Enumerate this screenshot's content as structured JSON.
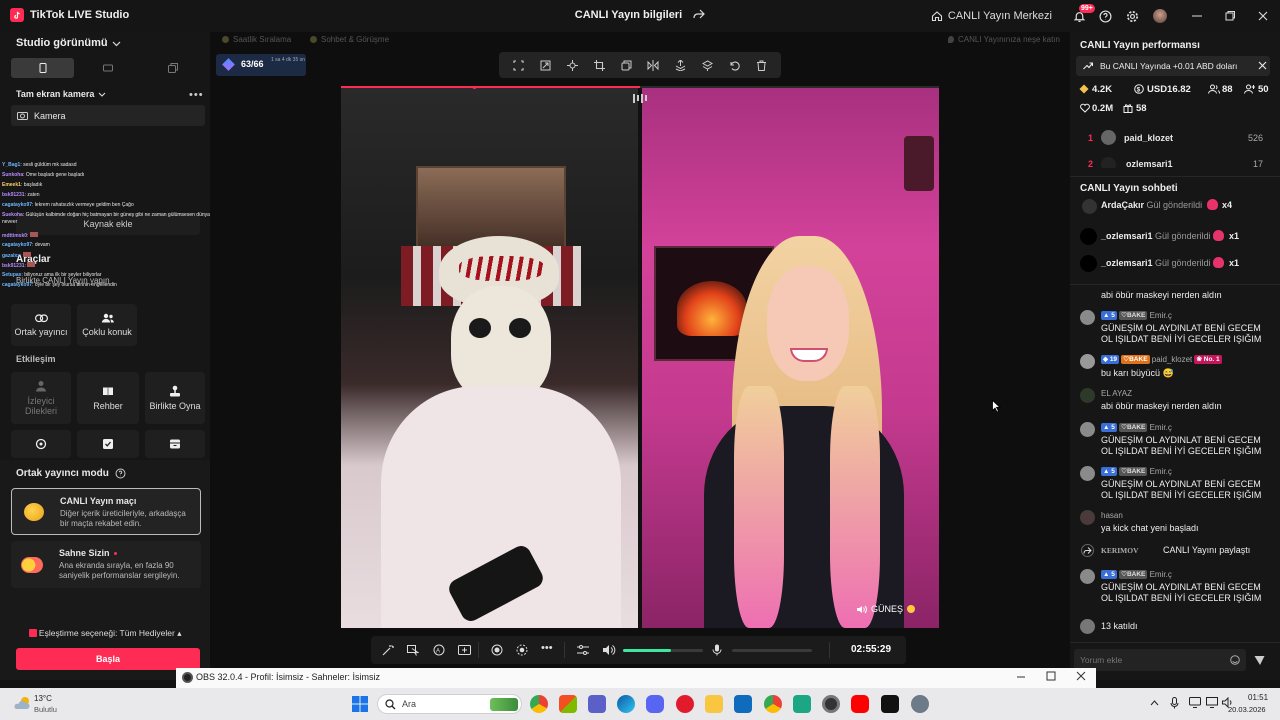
{
  "app": {
    "brand": "TikTok LIVE Studio",
    "title": "CANLI Yayın bilgileri",
    "center_button": "CANLI Yayın Merkezi",
    "notif_badge": "99+",
    "accent": "#fe2c55"
  },
  "left": {
    "studio_view": "Studio görünümü",
    "fullscreen_camera": "Tam ekran kamera",
    "camera": "Kamera",
    "add_source": "Kaynak ekle",
    "tools": "Araçlar",
    "play_together_note": "Birlikte CANLI Yayın yapın",
    "co_host": "Ortak yayıncı",
    "multi_guest": "Çoklu konuk",
    "interaction": "Etkileşim",
    "viewer_requests": "İzleyici Dilekleri",
    "guide": "Rehber",
    "play_together": "Birlikte Oyna",
    "co_host_mode": "Ortak yayıncı modu",
    "match_title": "CANLI Yayın maçı",
    "match_desc": "Diğer içerik üreticileriyle, arkadaşça bir maçta rekabet edin.",
    "stage_title": "Sahne Sizin",
    "stage_desc": "Ana ekranda sırayla, en fazla 90 saniyelik performanslar sergileyin.",
    "matching_option": "Eşleştirme seçeneği: Tüm Hediyeler",
    "start_button": "Başla",
    "overlay_chat": [
      {
        "user": "Y_Bag1",
        "text": "sesli güldüm mk sadasd",
        "color": "#6bb6ff"
      },
      {
        "user": "Sunkoha",
        "text": "Ome başladı gene başladı",
        "color": "#b88cff"
      },
      {
        "user": "Emeek1",
        "text": "başladık",
        "color": "#ffd166"
      },
      {
        "user": "bsk91231",
        "text": "zaten",
        "color": "#b88cff"
      },
      {
        "user": "cagatayko97",
        "text": "lekrem rahatsızlık vermeye geldim ben Çağo",
        "color": "#6bb6ff"
      },
      {
        "user": "Suekoha",
        "text": "Gülüşün kalbimde doğan hiç batmayan bir güneş gibi ne zaman gülümsesen dünyam",
        "color": "#b88cff"
      },
      {
        "user": "",
        "text": "neveer",
        "color": "#6bb6ff"
      },
      {
        "user": "mdttimsk0",
        "text": "",
        "color": "#b88cff"
      },
      {
        "user": "cagatayko97",
        "text": "devam",
        "color": "#6bb6ff"
      },
      {
        "user": "gazalxx",
        "text": "",
        "color": "#6bb6ff"
      },
      {
        "user": "bsk91231",
        "text": "",
        "color": "#b88cff"
      },
      {
        "user": "Setupas",
        "text": "biliyoruz ama ilk bir şeyler biliyorlar",
        "color": "#6bb6ff"
      },
      {
        "user": "cagatayko97",
        "text": "öyle bir şey olursa birinin engellendin",
        "color": "#6bb6ff"
      }
    ]
  },
  "stage": {
    "tab1": "Saatlik Sıralama",
    "tab2": "Sohbet & Görüşme",
    "right_hint": "CANLI Yayınınıza neşe katın",
    "counter": "63/66",
    "counter_sub": "1 sa 4 dk 35 sn",
    "guest_name": "GÜNEŞ",
    "timer": "02:55:29",
    "volume_level": 0.6
  },
  "right": {
    "performance_title": "CANLI Yayın performansı",
    "earn_note": "Bu CANLI Yayında +0.01 ABD doları",
    "stats": {
      "diamonds": "4.2K",
      "usd": "USD16.82",
      "viewers": "88",
      "followers": "50",
      "likes": "0.2M",
      "gifts": "58"
    },
    "top_viewers": [
      {
        "rank": "1",
        "name": "paid_klozet",
        "score": "526"
      },
      {
        "rank": "2",
        "name": "ozlemsari1",
        "score": "17"
      }
    ],
    "chat_title": "CANLI Yayın sohbeti",
    "gifts": [
      {
        "user": "ArdaÇakır",
        "action": "Gül gönderildi",
        "count": "x4"
      },
      {
        "user": "_ozlemsari1",
        "action": "Gül gönderildi",
        "count": "x1"
      },
      {
        "user": "_ozlemsari1",
        "action": "Gül gönderildi",
        "count": "x1"
      }
    ],
    "messages": {
      "m0": "abi öbür maskeyi nerden aldın",
      "m1_user": "Emir.ç",
      "m1_text": "GÜNEŞİM OL AYDINLAT BENİ GECEM OL IŞILDAT BENİ İYİ GECELER IŞIĞIM",
      "m2_user": "paid_klozet",
      "m2_level": "19",
      "m2_badge": "BAKE",
      "m2_no": "No. 1",
      "m2_text": "bu karı büyücü 😅",
      "m3_user": "EL AYAZ",
      "m3_text": "abi öbür maskeyi nerden aldın",
      "m4_user": "Emir.ç",
      "m4_text": "GÜNEŞİM OL AYDINLAT BENİ GECEM OL IŞILDAT BENİ İYİ GECELER IŞIĞIM",
      "m5_user": "Emir.ç",
      "m5_text": "GÜNEŞİM OL AYDINLAT BENİ GECEM OL IŞILDAT BENİ İYİ GECELER IŞIĞIM",
      "m6_user": "hasan",
      "m6_text": "ya kick chat yeni başladı",
      "m7_user": "KERIMOV",
      "m7_text": "CANLI Yayını paylaştı",
      "m8_user": "Emir.ç",
      "m8_text": "GÜNEŞİM OL AYDINLAT BENİ GECEM OL IŞILDAT BENİ İYİ GECELER IŞIĞIM",
      "m9_count": "13",
      "m9_text": "katıldı",
      "level": "5",
      "bake": "BAKE"
    },
    "comment_placeholder": "Yorum ekle"
  },
  "obs": {
    "title": "OBS 32.0.4 - Profil: İsimsiz - Sahneler: İsimsiz"
  },
  "taskbar": {
    "temp": "13°C",
    "weather": "Bulutlu",
    "search": "Ara",
    "time": "01:51",
    "date": "20.03.2026"
  }
}
